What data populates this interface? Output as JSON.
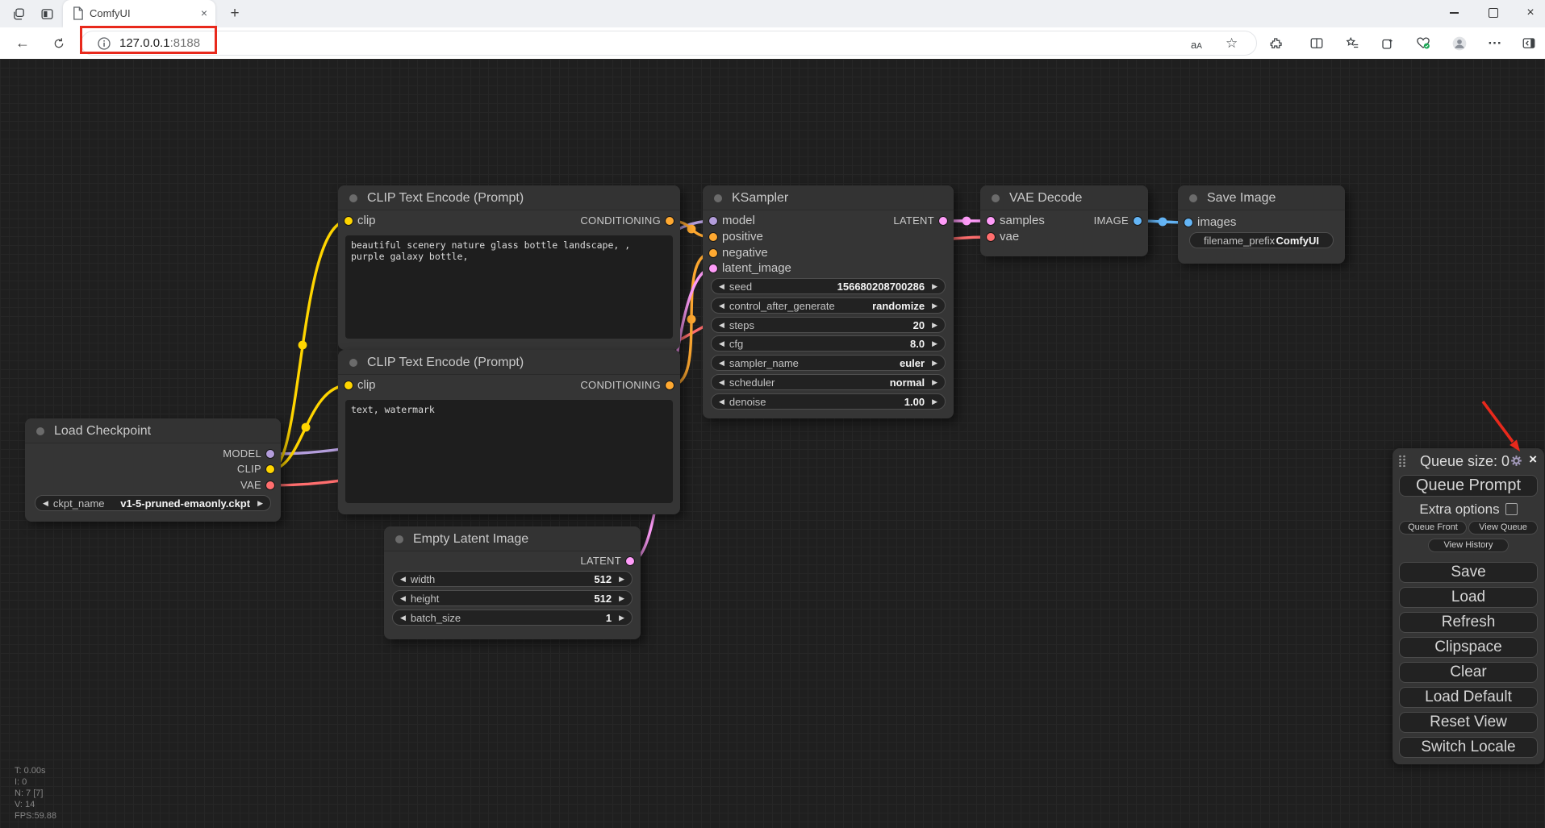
{
  "colors": {
    "model": "#B39DDB",
    "clip": "#FFD500",
    "vae": "#FF6E6E",
    "conditioning": "#FFA931",
    "latent": "#FF9CF9",
    "image": "#64B5F6",
    "annotation": "#E8291C"
  },
  "browser": {
    "tab_title": "ComfyUI",
    "url_host": "127.0.0.1",
    "url_port": ":8188",
    "glyphs": {
      "back": "←",
      "star": "☆",
      "dots": "···",
      "new_tab": "+",
      "tab_close": "×"
    }
  },
  "nodes": {
    "load_checkpoint": {
      "title": "Load Checkpoint",
      "outputs": [
        "MODEL",
        "CLIP",
        "VAE"
      ],
      "widget": {
        "name": "ckpt_name",
        "value": "v1-5-pruned-emaonly.ckpt"
      }
    },
    "clip_positive": {
      "title": "CLIP Text Encode (Prompt)",
      "input": "clip",
      "output": "CONDITIONING",
      "text": "beautiful scenery nature glass bottle landscape, , purple galaxy bottle,"
    },
    "clip_negative": {
      "title": "CLIP Text Encode (Prompt)",
      "input": "clip",
      "output": "CONDITIONING",
      "text": "text, watermark"
    },
    "ksampler": {
      "title": "KSampler",
      "inputs": [
        "model",
        "positive",
        "negative",
        "latent_image"
      ],
      "output": "LATENT",
      "widgets": [
        {
          "name": "seed",
          "value": "156680208700286"
        },
        {
          "name": "control_after_generate",
          "value": "randomize"
        },
        {
          "name": "steps",
          "value": "20"
        },
        {
          "name": "cfg",
          "value": "8.0"
        },
        {
          "name": "sampler_name",
          "value": "euler"
        },
        {
          "name": "scheduler",
          "value": "normal"
        },
        {
          "name": "denoise",
          "value": "1.00"
        }
      ]
    },
    "vae_decode": {
      "title": "VAE Decode",
      "inputs": [
        "samples",
        "vae"
      ],
      "output": "IMAGE"
    },
    "save_image": {
      "title": "Save Image",
      "input": "images",
      "widget": {
        "name": "filename_prefix",
        "value": "ComfyUI"
      }
    },
    "empty_latent": {
      "title": "Empty Latent Image",
      "output": "LATENT",
      "widgets": [
        {
          "name": "width",
          "value": "512"
        },
        {
          "name": "height",
          "value": "512"
        },
        {
          "name": "batch_size",
          "value": "1"
        }
      ]
    }
  },
  "menu": {
    "queue_size": "Queue size: 0",
    "close": "×",
    "queue_prompt": "Queue Prompt",
    "extra_options": "Extra options",
    "queue_front": "Queue Front",
    "view_queue": "View Queue",
    "view_history": "View History",
    "buttons": [
      "Save",
      "Load",
      "Refresh",
      "Clipspace",
      "Clear",
      "Load Default",
      "Reset View",
      "Switch Locale"
    ]
  },
  "stats": {
    "lines": [
      "T: 0.00s",
      "I: 0",
      "N: 7 [7]",
      "V: 14",
      "FPS:59.88"
    ]
  }
}
